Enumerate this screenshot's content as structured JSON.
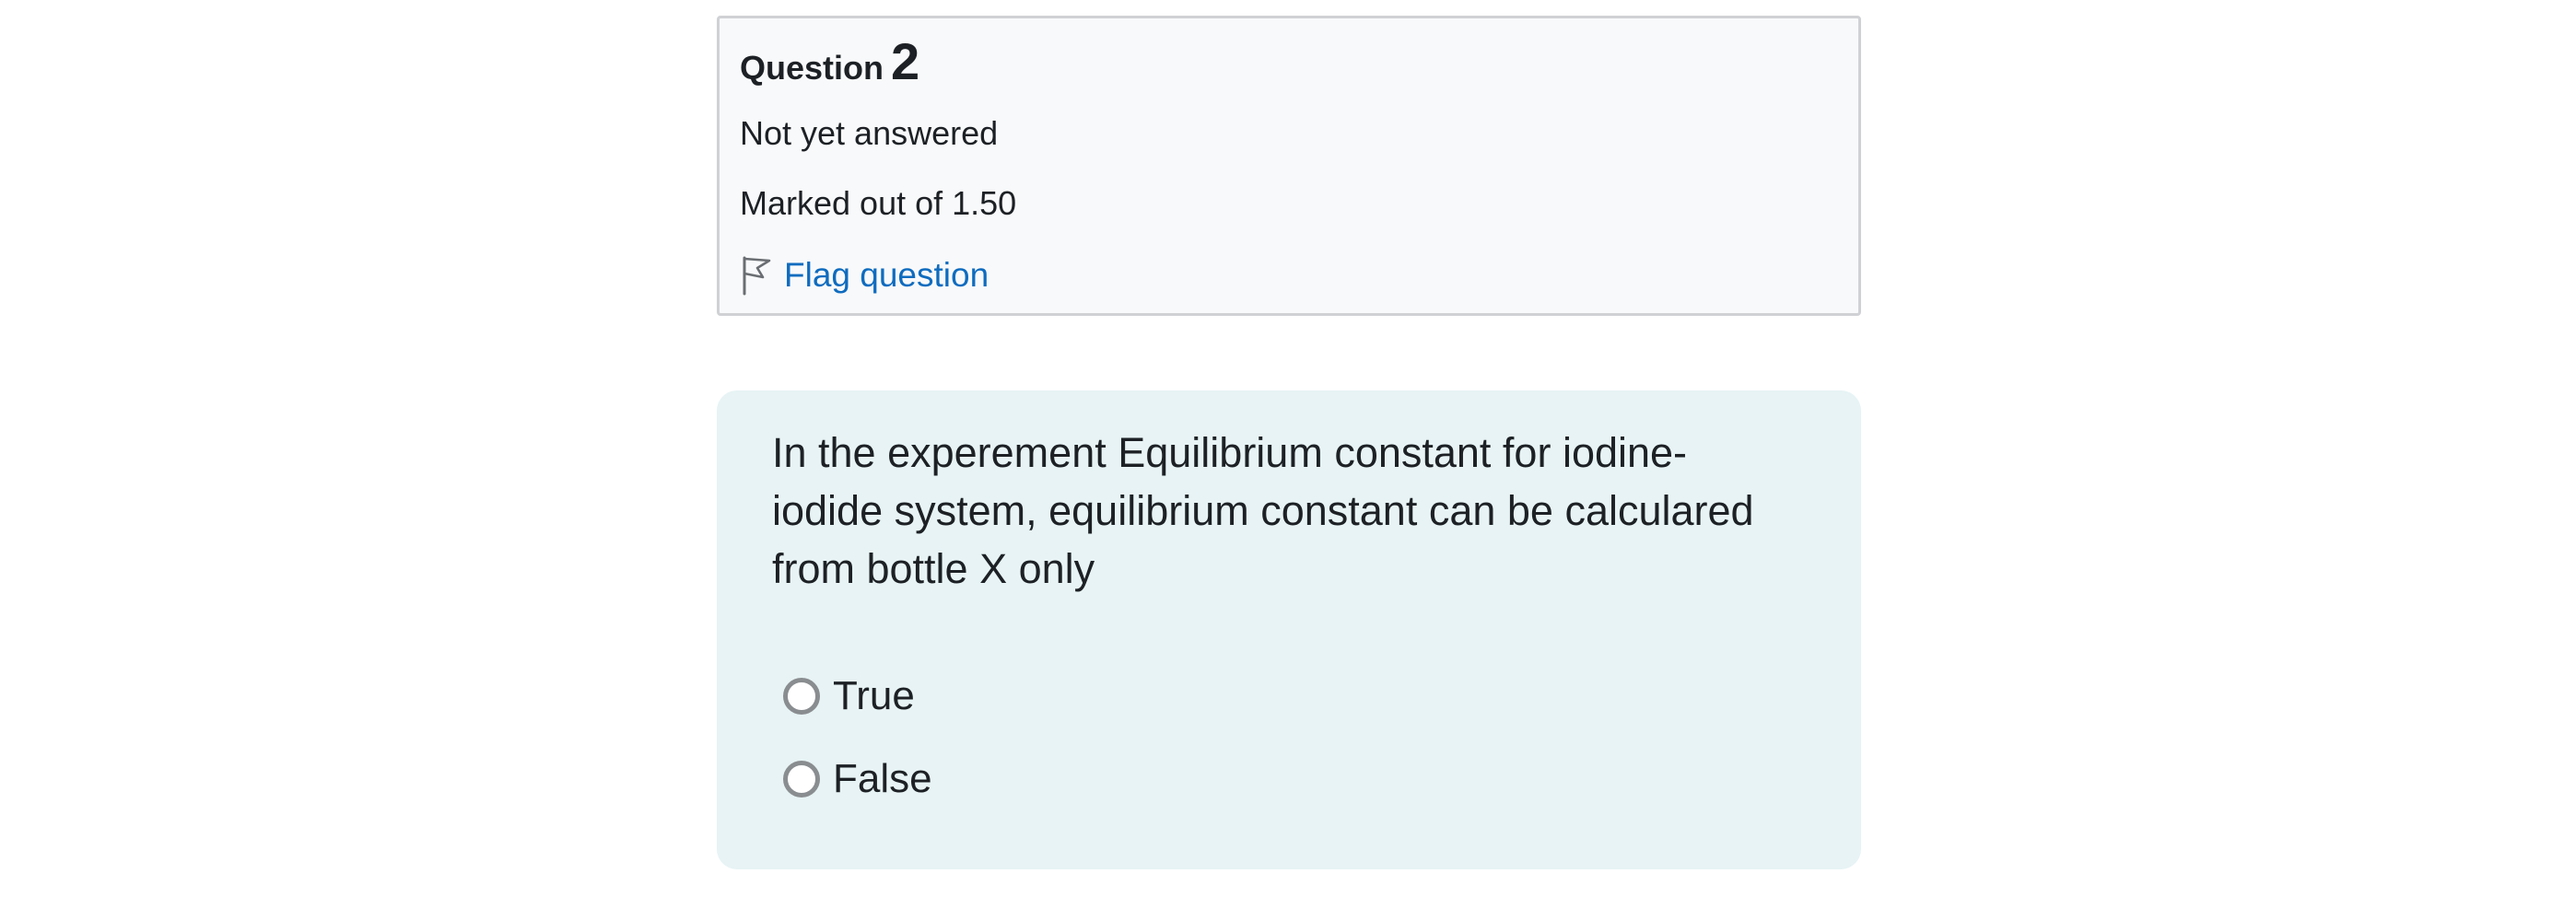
{
  "question_info": {
    "label_word": "Question",
    "number": "2",
    "state": "Not yet answered",
    "grade": "Marked out of 1.50",
    "flag_label": "Flag question",
    "flag_icon": "flag-outline-icon"
  },
  "question": {
    "text": "In the experement Equilibrium constant for iodine-iodide system, equilibrium constant can be calculared from bottle X only",
    "options": [
      {
        "label": "True",
        "selected": false
      },
      {
        "label": "False",
        "selected": false
      }
    ]
  },
  "colors": {
    "info_background": "#f8f9fa",
    "content_background": "#e7f3f5",
    "link": "#0f6cbf",
    "text": "#1d2125"
  }
}
